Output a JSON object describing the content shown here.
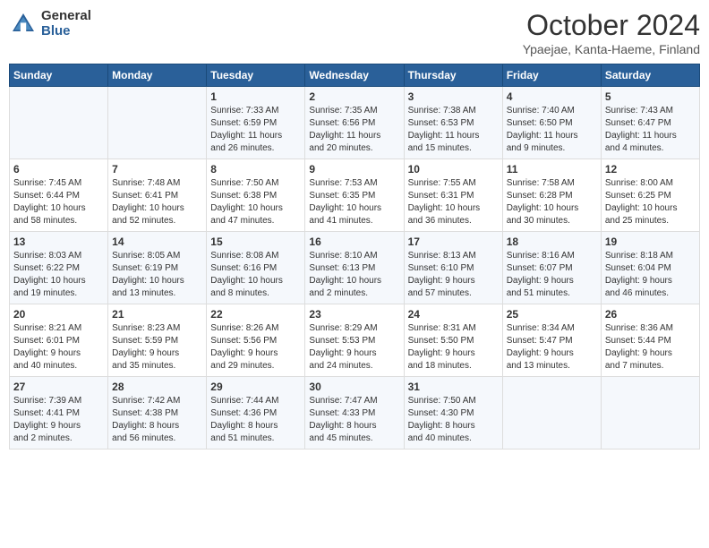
{
  "header": {
    "logo_general": "General",
    "logo_blue": "Blue",
    "month_title": "October 2024",
    "location": "Ypaejae, Kanta-Haeme, Finland"
  },
  "days_of_week": [
    "Sunday",
    "Monday",
    "Tuesday",
    "Wednesday",
    "Thursday",
    "Friday",
    "Saturday"
  ],
  "weeks": [
    [
      {
        "day": "",
        "content": ""
      },
      {
        "day": "",
        "content": ""
      },
      {
        "day": "1",
        "content": "Sunrise: 7:33 AM\nSunset: 6:59 PM\nDaylight: 11 hours\nand 26 minutes."
      },
      {
        "day": "2",
        "content": "Sunrise: 7:35 AM\nSunset: 6:56 PM\nDaylight: 11 hours\nand 20 minutes."
      },
      {
        "day": "3",
        "content": "Sunrise: 7:38 AM\nSunset: 6:53 PM\nDaylight: 11 hours\nand 15 minutes."
      },
      {
        "day": "4",
        "content": "Sunrise: 7:40 AM\nSunset: 6:50 PM\nDaylight: 11 hours\nand 9 minutes."
      },
      {
        "day": "5",
        "content": "Sunrise: 7:43 AM\nSunset: 6:47 PM\nDaylight: 11 hours\nand 4 minutes."
      }
    ],
    [
      {
        "day": "6",
        "content": "Sunrise: 7:45 AM\nSunset: 6:44 PM\nDaylight: 10 hours\nand 58 minutes."
      },
      {
        "day": "7",
        "content": "Sunrise: 7:48 AM\nSunset: 6:41 PM\nDaylight: 10 hours\nand 52 minutes."
      },
      {
        "day": "8",
        "content": "Sunrise: 7:50 AM\nSunset: 6:38 PM\nDaylight: 10 hours\nand 47 minutes."
      },
      {
        "day": "9",
        "content": "Sunrise: 7:53 AM\nSunset: 6:35 PM\nDaylight: 10 hours\nand 41 minutes."
      },
      {
        "day": "10",
        "content": "Sunrise: 7:55 AM\nSunset: 6:31 PM\nDaylight: 10 hours\nand 36 minutes."
      },
      {
        "day": "11",
        "content": "Sunrise: 7:58 AM\nSunset: 6:28 PM\nDaylight: 10 hours\nand 30 minutes."
      },
      {
        "day": "12",
        "content": "Sunrise: 8:00 AM\nSunset: 6:25 PM\nDaylight: 10 hours\nand 25 minutes."
      }
    ],
    [
      {
        "day": "13",
        "content": "Sunrise: 8:03 AM\nSunset: 6:22 PM\nDaylight: 10 hours\nand 19 minutes."
      },
      {
        "day": "14",
        "content": "Sunrise: 8:05 AM\nSunset: 6:19 PM\nDaylight: 10 hours\nand 13 minutes."
      },
      {
        "day": "15",
        "content": "Sunrise: 8:08 AM\nSunset: 6:16 PM\nDaylight: 10 hours\nand 8 minutes."
      },
      {
        "day": "16",
        "content": "Sunrise: 8:10 AM\nSunset: 6:13 PM\nDaylight: 10 hours\nand 2 minutes."
      },
      {
        "day": "17",
        "content": "Sunrise: 8:13 AM\nSunset: 6:10 PM\nDaylight: 9 hours\nand 57 minutes."
      },
      {
        "day": "18",
        "content": "Sunrise: 8:16 AM\nSunset: 6:07 PM\nDaylight: 9 hours\nand 51 minutes."
      },
      {
        "day": "19",
        "content": "Sunrise: 8:18 AM\nSunset: 6:04 PM\nDaylight: 9 hours\nand 46 minutes."
      }
    ],
    [
      {
        "day": "20",
        "content": "Sunrise: 8:21 AM\nSunset: 6:01 PM\nDaylight: 9 hours\nand 40 minutes."
      },
      {
        "day": "21",
        "content": "Sunrise: 8:23 AM\nSunset: 5:59 PM\nDaylight: 9 hours\nand 35 minutes."
      },
      {
        "day": "22",
        "content": "Sunrise: 8:26 AM\nSunset: 5:56 PM\nDaylight: 9 hours\nand 29 minutes."
      },
      {
        "day": "23",
        "content": "Sunrise: 8:29 AM\nSunset: 5:53 PM\nDaylight: 9 hours\nand 24 minutes."
      },
      {
        "day": "24",
        "content": "Sunrise: 8:31 AM\nSunset: 5:50 PM\nDaylight: 9 hours\nand 18 minutes."
      },
      {
        "day": "25",
        "content": "Sunrise: 8:34 AM\nSunset: 5:47 PM\nDaylight: 9 hours\nand 13 minutes."
      },
      {
        "day": "26",
        "content": "Sunrise: 8:36 AM\nSunset: 5:44 PM\nDaylight: 9 hours\nand 7 minutes."
      }
    ],
    [
      {
        "day": "27",
        "content": "Sunrise: 7:39 AM\nSunset: 4:41 PM\nDaylight: 9 hours\nand 2 minutes."
      },
      {
        "day": "28",
        "content": "Sunrise: 7:42 AM\nSunset: 4:38 PM\nDaylight: 8 hours\nand 56 minutes."
      },
      {
        "day": "29",
        "content": "Sunrise: 7:44 AM\nSunset: 4:36 PM\nDaylight: 8 hours\nand 51 minutes."
      },
      {
        "day": "30",
        "content": "Sunrise: 7:47 AM\nSunset: 4:33 PM\nDaylight: 8 hours\nand 45 minutes."
      },
      {
        "day": "31",
        "content": "Sunrise: 7:50 AM\nSunset: 4:30 PM\nDaylight: 8 hours\nand 40 minutes."
      },
      {
        "day": "",
        "content": ""
      },
      {
        "day": "",
        "content": ""
      }
    ]
  ]
}
